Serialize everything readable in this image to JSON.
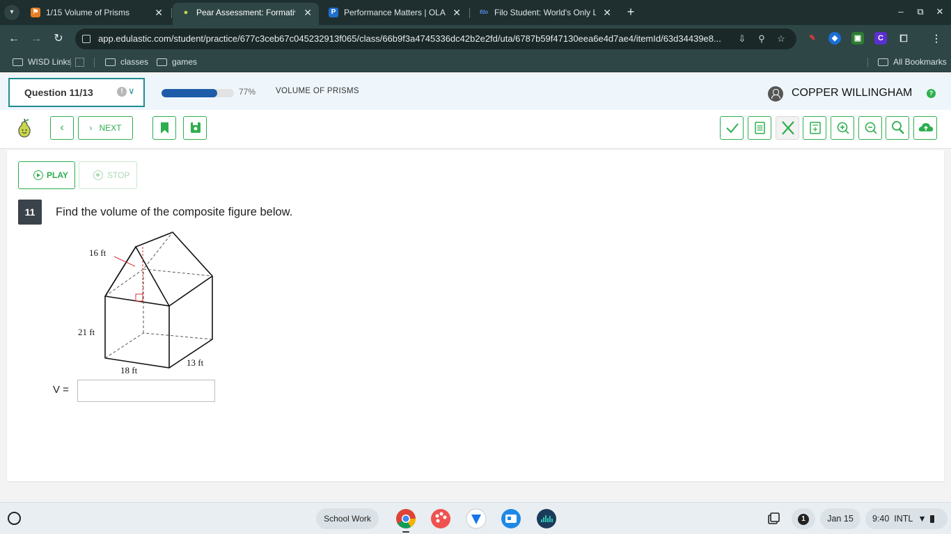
{
  "browser": {
    "tabs": [
      {
        "title": "1/15 Volume of Prisms",
        "favicon_color": "#e67e22",
        "favicon_glyph": "person-icon",
        "active": false
      },
      {
        "title": "Pear Assessment: Formative a",
        "favicon_color": "#7cb342",
        "favicon_glyph": "pear-icon",
        "active": true
      },
      {
        "title": "Performance Matters | OLA",
        "favicon_color": "#1e6fd0",
        "favicon_glyph": "P",
        "active": false
      },
      {
        "title": "Filo Student: World's Only Live",
        "favicon_color": "#3a6fe0",
        "favicon_glyph": "filo",
        "active": false
      }
    ],
    "url": "app.edulastic.com/student/practice/677c3ceb67c045232913f065/class/66b9f3a4745336dc42b2e2fd/uta/6787b59f47130eea6e4d7ae4/itemId/63d34439e8...",
    "bookmarks": [
      {
        "label": "WISD Links",
        "icon": "folder-icon"
      },
      {
        "label": "",
        "icon": "apps-grid-icon"
      },
      {
        "label": "classes",
        "icon": "folder-icon"
      },
      {
        "label": "games",
        "icon": "folder-icon"
      },
      {
        "label": "All Bookmarks",
        "icon": "folder-icon"
      }
    ]
  },
  "assessment": {
    "question_selector": "Question 11/13",
    "progress_percent": 77,
    "progress_label": "77%",
    "assignment_title": "VOLUME OF PRISMS",
    "student_name": "COPPER WILLINGHAM",
    "next_label": "NEXT",
    "play_label": "PLAY",
    "stop_label": "STOP",
    "question_number": "11",
    "question_text": "Find the volume of the composite figure below.",
    "answer_label": "V =",
    "answer_value": "",
    "figure_labels": {
      "top": "16 ft",
      "left": "21 ft",
      "bottom": "18 ft",
      "right": "13 ft"
    },
    "accent_color": "#2eae4e",
    "progress_color": "#1e5ba8"
  },
  "shelf": {
    "desk_label": "School Work",
    "notification_count": "1",
    "date": "Jan 15",
    "time": "9:40",
    "input_method": "INTL"
  }
}
